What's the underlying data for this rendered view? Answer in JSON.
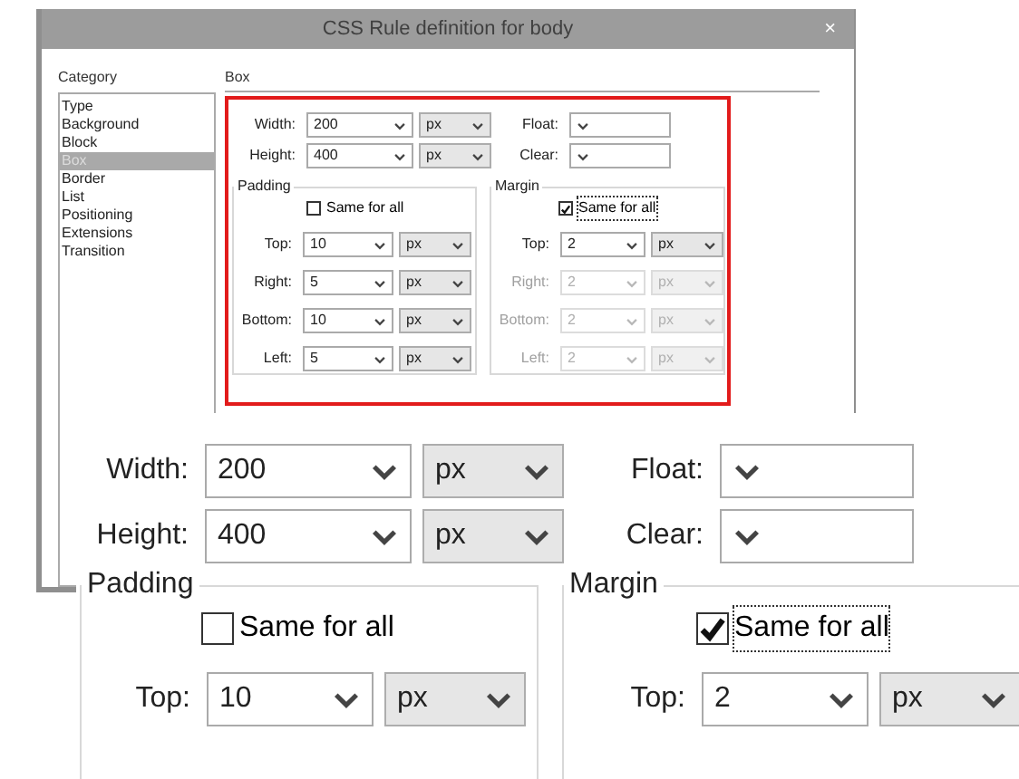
{
  "window": {
    "title": "CSS Rule definition for body",
    "close": "×"
  },
  "category": {
    "label": "Category",
    "items": [
      {
        "label": "Type",
        "selected": false
      },
      {
        "label": "Background",
        "selected": false
      },
      {
        "label": "Block",
        "selected": false
      },
      {
        "label": "Box",
        "selected": true
      },
      {
        "label": "Border",
        "selected": false
      },
      {
        "label": "List",
        "selected": false
      },
      {
        "label": "Positioning",
        "selected": false
      },
      {
        "label": "Extensions",
        "selected": false
      },
      {
        "label": "Transition",
        "selected": false
      }
    ]
  },
  "panel": {
    "title": "Box",
    "width": {
      "label": "Width:",
      "value": "200",
      "unit": "px"
    },
    "height": {
      "label": "Height:",
      "value": "400",
      "unit": "px"
    },
    "float": {
      "label": "Float:"
    },
    "clear": {
      "label": "Clear:"
    },
    "padding": {
      "legend": "Padding",
      "same_for_all": {
        "label": "Same for all",
        "checked": false
      },
      "fields": [
        {
          "label": "Top:",
          "value": "10",
          "unit": "px",
          "disabled": false
        },
        {
          "label": "Right:",
          "value": "5",
          "unit": "px",
          "disabled": false
        },
        {
          "label": "Bottom:",
          "value": "10",
          "unit": "px",
          "disabled": false
        },
        {
          "label": "Left:",
          "value": "5",
          "unit": "px",
          "disabled": false
        }
      ]
    },
    "margin": {
      "legend": "Margin",
      "same_for_all": {
        "label": "Same for all",
        "checked": true
      },
      "fields": [
        {
          "label": "Top:",
          "value": "2",
          "unit": "px",
          "disabled": false
        },
        {
          "label": "Right:",
          "value": "2",
          "unit": "px",
          "disabled": true
        },
        {
          "label": "Bottom:",
          "value": "2",
          "unit": "px",
          "disabled": true
        },
        {
          "label": "Left:",
          "value": "2",
          "unit": "px",
          "disabled": true
        }
      ]
    }
  },
  "zoom_inset": {
    "width": {
      "label": "Width:",
      "value": "200",
      "unit": "px"
    },
    "height": {
      "label": "Height:",
      "value": "400",
      "unit": "px"
    },
    "float": {
      "label": "Float:"
    },
    "clear": {
      "label": "Clear:"
    },
    "padding": {
      "legend": "Padding",
      "same_for_all": {
        "label": "Same for all",
        "checked": false
      },
      "fields": [
        {
          "label": "Top:",
          "value": "10",
          "unit": "px",
          "disabled": false
        }
      ]
    },
    "margin": {
      "legend": "Margin",
      "same_for_all": {
        "label": "Same for all",
        "checked": true
      },
      "fields": [
        {
          "label": "Top:",
          "value": "2",
          "unit": "px",
          "disabled": false
        }
      ]
    }
  }
}
